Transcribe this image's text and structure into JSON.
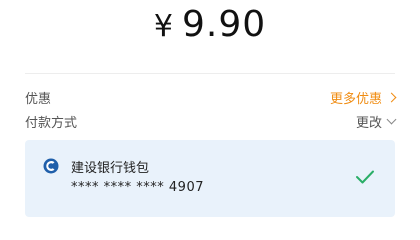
{
  "payment": {
    "currency_symbol": "¥",
    "amount": "9.90"
  },
  "discount": {
    "label": "优惠",
    "action": "更多优惠"
  },
  "method": {
    "label": "付款方式",
    "action": "更改"
  },
  "card": {
    "bank_name": "建设银行钱包",
    "masked_number": "**** **** **** 4907",
    "selected": true
  },
  "colors": {
    "accent_orange": "#f08c12",
    "card_bg": "#e9f2fb",
    "check_green": "#2aae67",
    "bank_blue": "#1f5faa"
  },
  "icons": {
    "bank": "ccb-bank-logo-icon",
    "discount_arrow": "chevron-right-icon",
    "method_arrow": "chevron-down-icon",
    "selected": "check-icon"
  }
}
